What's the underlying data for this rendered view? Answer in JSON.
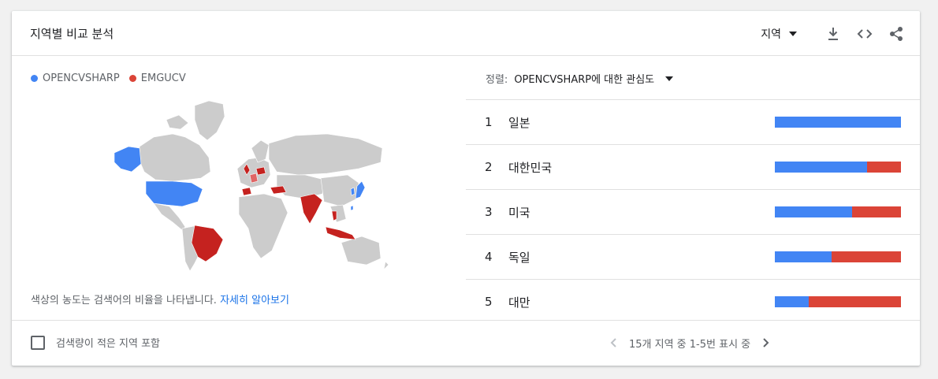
{
  "header": {
    "title": "지역별 비교 분석",
    "region_select_label": "지역",
    "icons": [
      "download-icon",
      "embed-code-icon",
      "share-icon"
    ]
  },
  "legend": [
    {
      "label": "OPENCVSHARP",
      "color": "#4285f4"
    },
    {
      "label": "EMGUCV",
      "color": "#db4437"
    }
  ],
  "map": {
    "highlight_colors": {
      "blue": "#4285f4",
      "red": "#c5221f",
      "land": "#cccccc"
    }
  },
  "caption": {
    "text": "색상의 농도는 검색어의 비율을 나타냅니다.",
    "link": "자세히 알아보기"
  },
  "sort": {
    "label": "정렬:",
    "value": "OPENCVSHARP에 대한 관심도"
  },
  "ranking": [
    {
      "rank": "1",
      "name": "일본",
      "blue_pct": 100,
      "red_pct": 0
    },
    {
      "rank": "2",
      "name": "대한민국",
      "blue_pct": 73,
      "red_pct": 27
    },
    {
      "rank": "3",
      "name": "미국",
      "blue_pct": 61,
      "red_pct": 39
    },
    {
      "rank": "4",
      "name": "독일",
      "blue_pct": 45,
      "red_pct": 55
    },
    {
      "rank": "5",
      "name": "대만",
      "blue_pct": 27,
      "red_pct": 73
    }
  ],
  "footer": {
    "checkbox_label": "검색량이 적은 지역 포함",
    "pager_text": "15개 지역 중 1-5번 표시 중"
  }
}
